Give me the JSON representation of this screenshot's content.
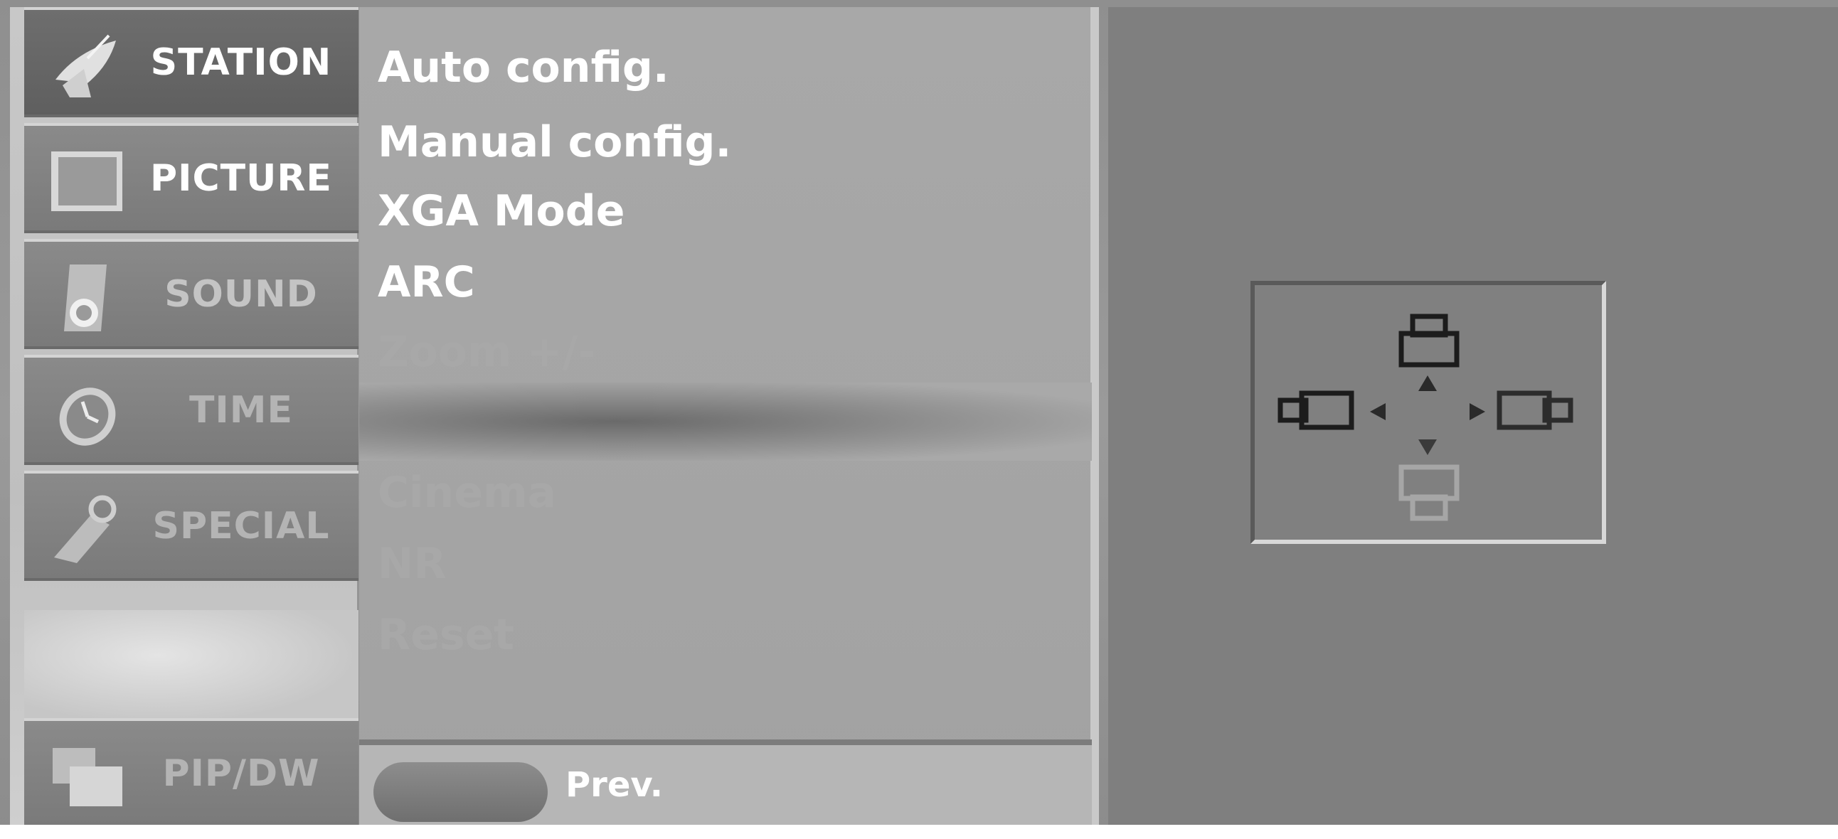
{
  "sidebar": {
    "items": [
      {
        "label": "STATION",
        "icon": "satellite-dish-icon"
      },
      {
        "label": "PICTURE",
        "icon": "picture-icon"
      },
      {
        "label": "SOUND",
        "icon": "speaker-icon"
      },
      {
        "label": "TIME",
        "icon": "clock-icon"
      },
      {
        "label": "SPECIAL",
        "icon": "tag-icon"
      },
      {
        "label": "PIP/DW",
        "icon": "pip-icon"
      }
    ]
  },
  "menu": {
    "items": [
      {
        "label": "Auto config."
      },
      {
        "label": "Manual config."
      },
      {
        "label": "XGA Mode"
      },
      {
        "label": "ARC"
      },
      {
        "label": "Zoom +/-"
      },
      {
        "label": ""
      },
      {
        "label": "Cinema"
      },
      {
        "label": "NR"
      },
      {
        "label": "Reset"
      }
    ]
  },
  "footer": {
    "prev_label": "Prev."
  },
  "position_panel": {
    "icons": [
      "screen-up-icon",
      "screen-left-icon",
      "screen-right-icon",
      "screen-down-icon"
    ],
    "arrows": [
      "arrow-up-icon",
      "arrow-left-icon",
      "arrow-right-icon",
      "arrow-down-icon"
    ]
  }
}
